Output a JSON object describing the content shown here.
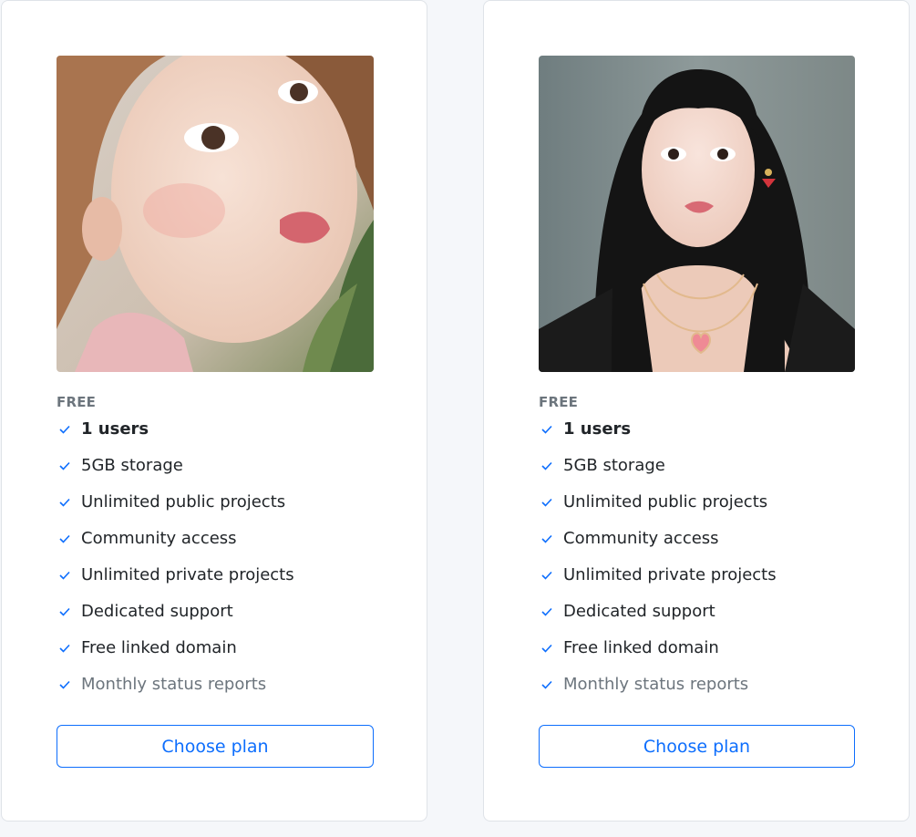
{
  "accent_color": "#0d6efd",
  "cards": [
    {
      "photo_alt": "Portrait of a woman with light brown hair",
      "tier": "FREE",
      "features": [
        "1 users",
        "5GB storage",
        "Unlimited public projects",
        "Community access",
        "Unlimited private projects",
        "Dedicated support",
        "Free linked domain",
        "Monthly status reports"
      ],
      "button_label": "Choose plan"
    },
    {
      "photo_alt": "Portrait of a woman with long black hair",
      "tier": "FREE",
      "features": [
        "1 users",
        "5GB storage",
        "Unlimited public projects",
        "Community access",
        "Unlimited private projects",
        "Dedicated support",
        "Free linked domain",
        "Monthly status reports"
      ],
      "button_label": "Choose plan"
    }
  ]
}
